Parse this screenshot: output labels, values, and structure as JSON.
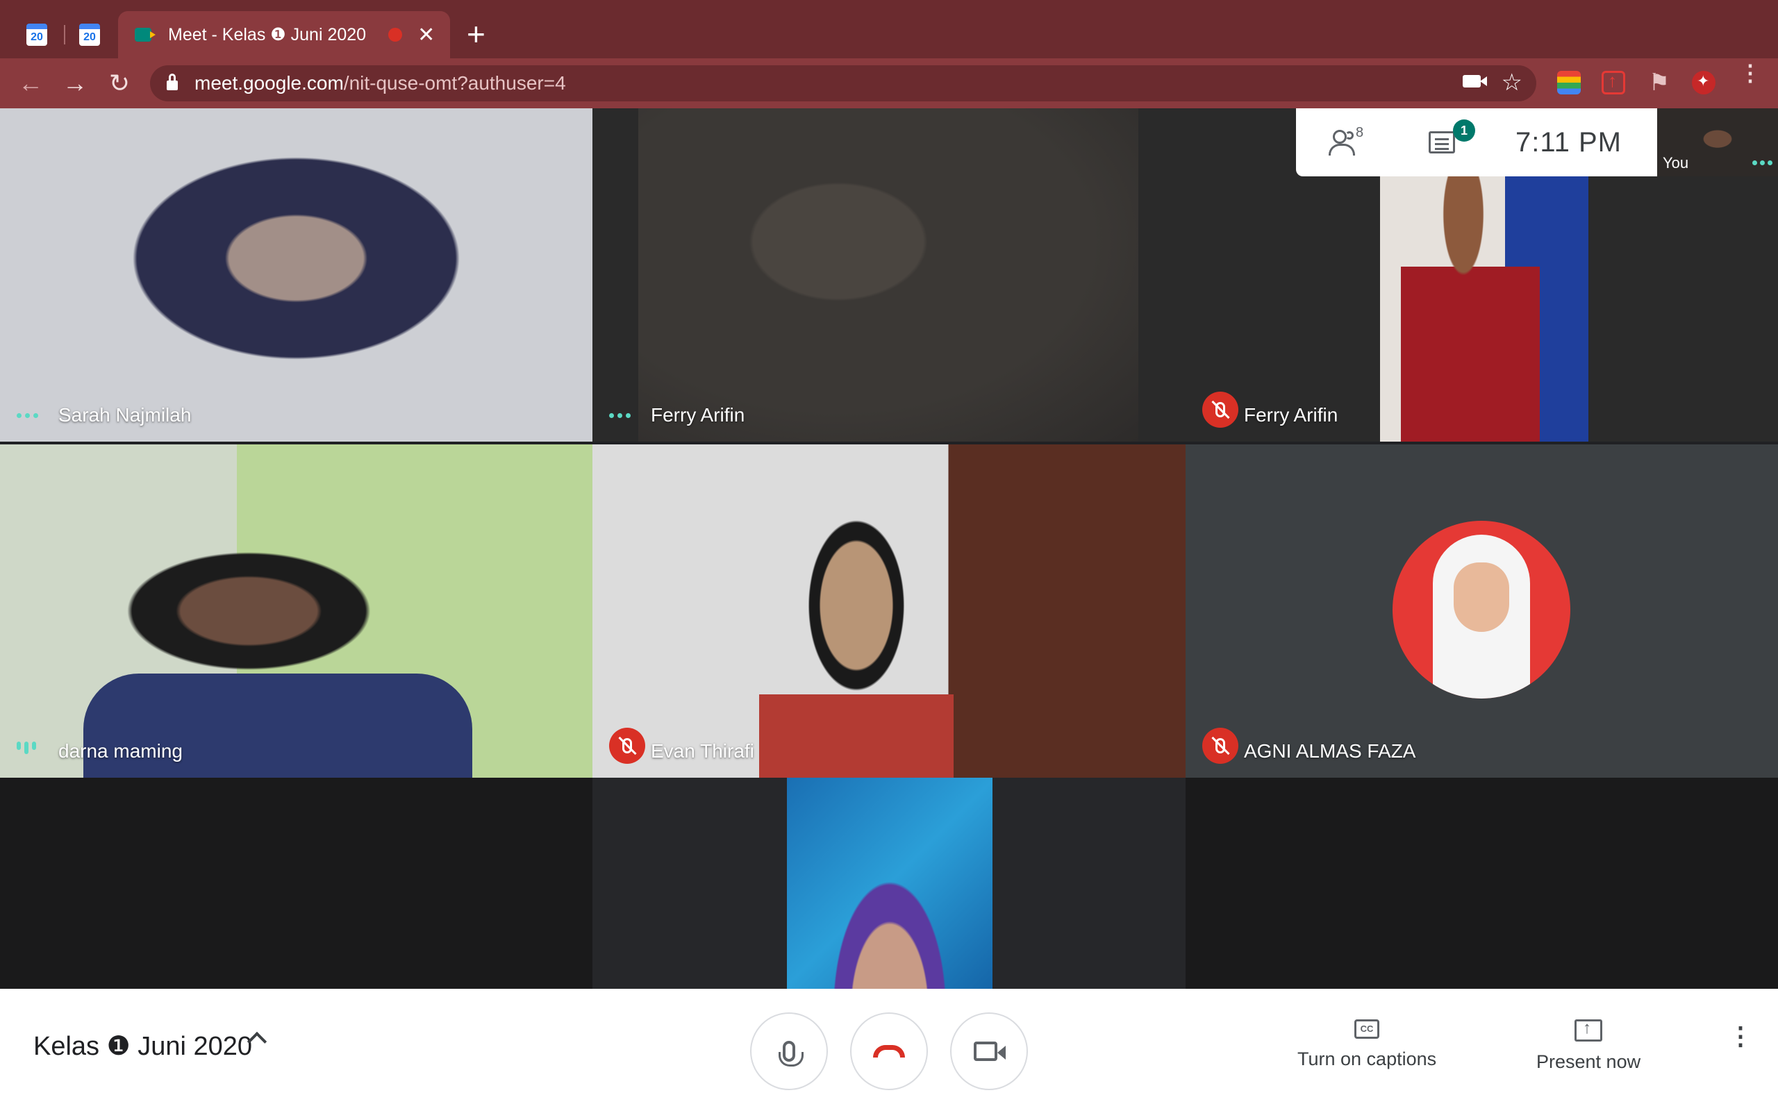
{
  "browser": {
    "pinned_tabs": [
      {
        "icon": "calendar-icon",
        "text": "20"
      },
      {
        "icon": "calendar-icon",
        "text": "20"
      }
    ],
    "active_tab": {
      "icon": "google-meet-icon",
      "title": "Meet - Kelas ❶ Juni 2020",
      "close": "✕"
    },
    "new_tab": "+",
    "url_host": "meet.google.com",
    "url_path": "/nit-quse-omt?authuser=4",
    "back": "←",
    "forward": "→",
    "reload": "↻",
    "star": "☆",
    "puzzle": "⚑",
    "menu": "⋮"
  },
  "info_panel": {
    "participants_count": "8",
    "chat_badge": "1",
    "time": "7:11  PM"
  },
  "self_view": {
    "label": "You"
  },
  "tiles": [
    {
      "name": "Sarah Najmilah",
      "status": "speaking-dots"
    },
    {
      "name": "Ferry Arifin",
      "status": "speaking-dots"
    },
    {
      "name": "Ferry Arifin",
      "status": "muted"
    },
    {
      "name": "darna maming",
      "status": "speaking-bars"
    },
    {
      "name": "Evan Thirafi",
      "status": "muted"
    },
    {
      "name": "AGNI ALMAS FAZA",
      "status": "muted"
    }
  ],
  "bottom_bar": {
    "meeting_name": "Kelas ❶ Juni 2020",
    "captions_label": "Turn on captions",
    "cc_icon_text": "CC",
    "present_label": "Present now",
    "more": "⋮"
  },
  "colors": {
    "tab_strip": "#6b2b2f",
    "toolbar": "#8a3a3e",
    "mute_red": "#d93025",
    "active_dots": "#5bd9c4"
  }
}
